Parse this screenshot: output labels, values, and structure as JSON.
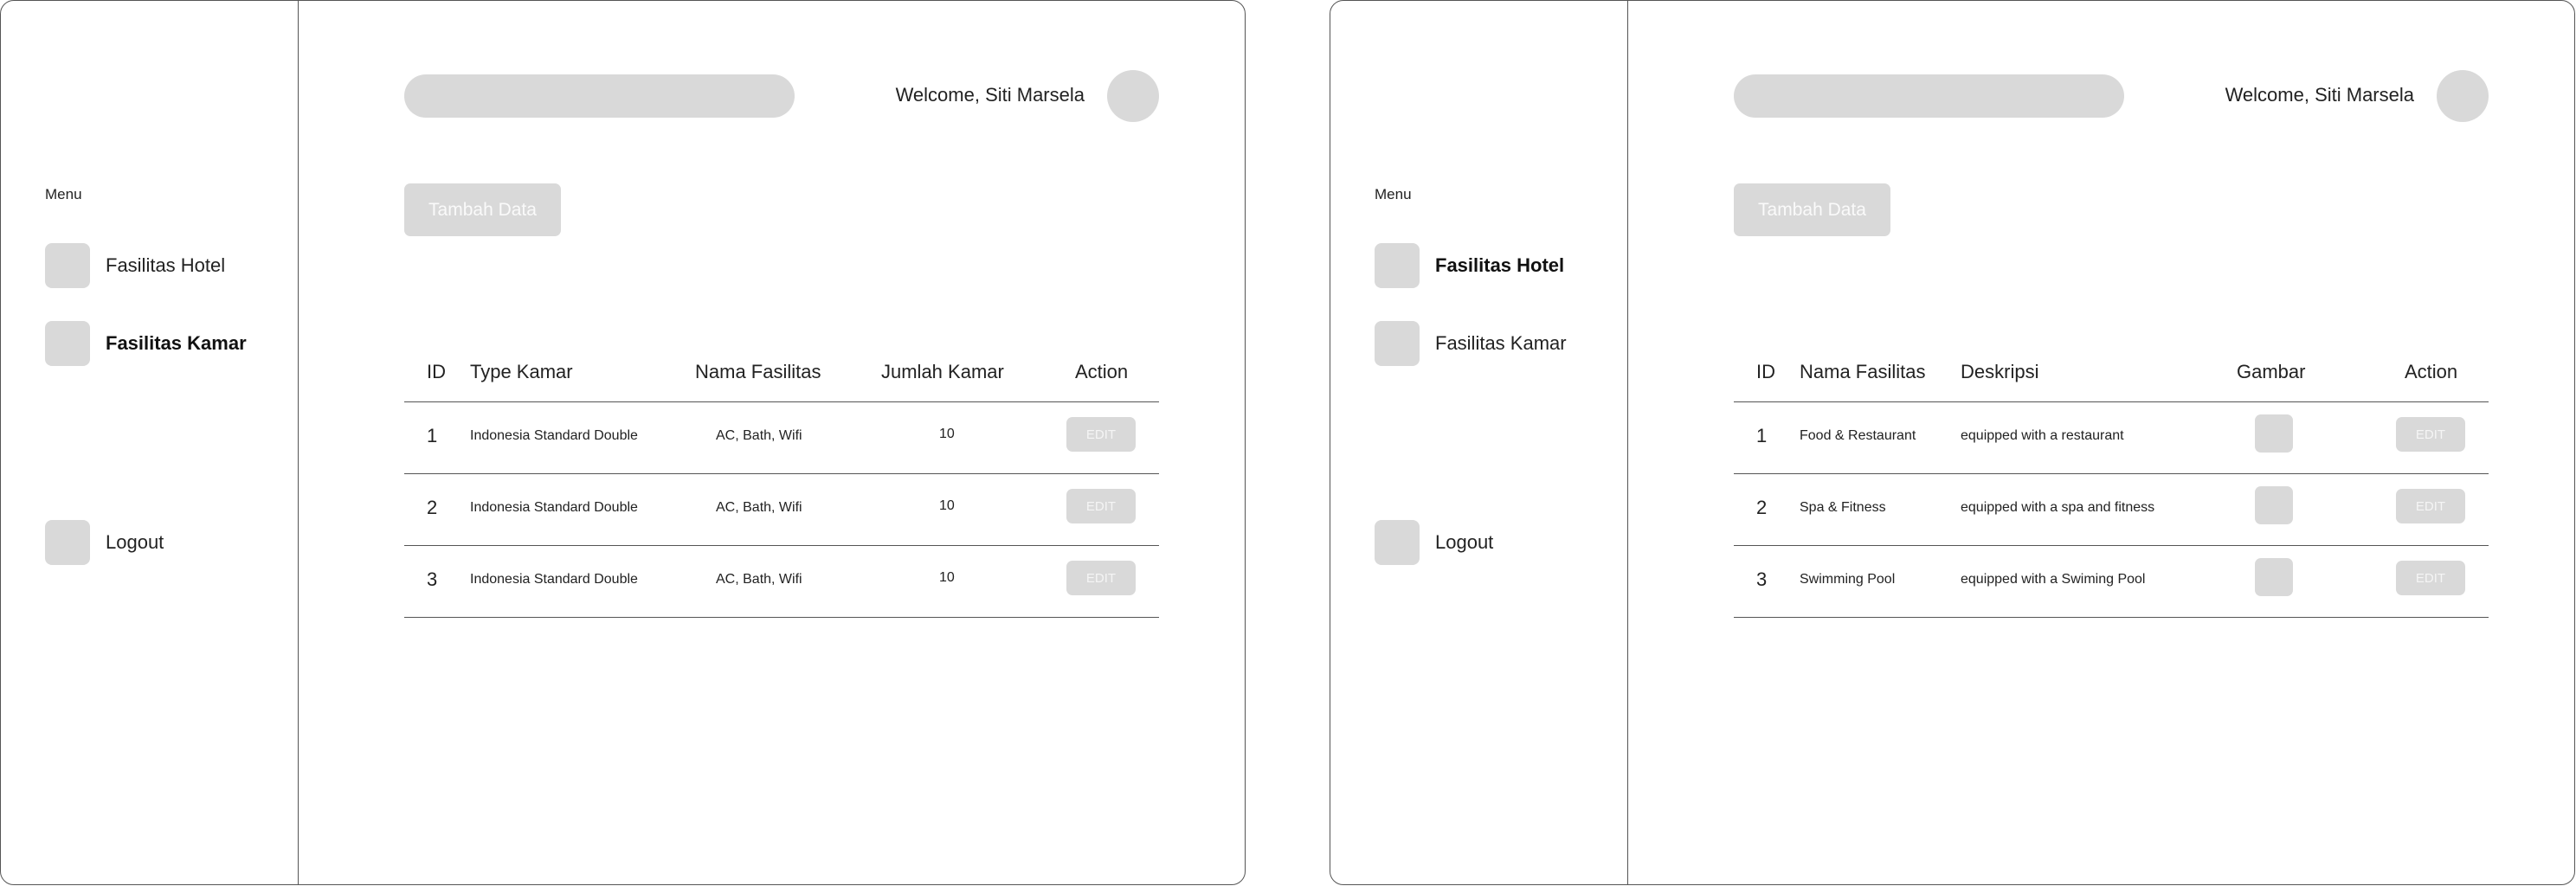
{
  "sidebar": {
    "menu_label": "Menu",
    "items": [
      {
        "label": "Fasilitas Hotel",
        "icon": "hotel-icon"
      },
      {
        "label": "Fasilitas Kamar",
        "icon": "room-icon"
      },
      {
        "label": "Logout",
        "icon": "logout-icon"
      }
    ]
  },
  "header": {
    "welcome_text": "Welcome, Siti Marsela"
  },
  "actions": {
    "add_label": "Tambah Data",
    "edit_label": "EDIT"
  },
  "kamar_table": {
    "active_menu": "Fasilitas Kamar",
    "columns": [
      "ID",
      "Type Kamar",
      "Nama Fasilitas",
      "Jumlah Kamar",
      "Action"
    ],
    "rows": [
      {
        "id": "1",
        "type": "Indonesia Standard Double",
        "fasilitas": "AC, Bath, Wifi",
        "jumlah": "10"
      },
      {
        "id": "2",
        "type": "Indonesia Standard Double",
        "fasilitas": "AC, Bath, Wifi",
        "jumlah": "10"
      },
      {
        "id": "3",
        "type": "Indonesia Standard Double",
        "fasilitas": "AC, Bath, Wifi",
        "jumlah": "10"
      }
    ]
  },
  "hotel_table": {
    "active_menu": "Fasilitas Hotel",
    "columns": [
      "ID",
      "Nama Fasilitas",
      "Deskripsi",
      "Gambar",
      "Action"
    ],
    "rows": [
      {
        "id": "1",
        "nama": "Food & Restaurant",
        "deskripsi": "equipped with a restaurant"
      },
      {
        "id": "2",
        "nama": "Spa & Fitness",
        "deskripsi": "equipped with a spa and fitness"
      },
      {
        "id": "3",
        "nama": "Swimming Pool",
        "deskripsi": "equipped with a Swiming Pool"
      }
    ]
  },
  "colors": {
    "placeholder_gray": "#d9d9d9",
    "border": "#555555"
  }
}
